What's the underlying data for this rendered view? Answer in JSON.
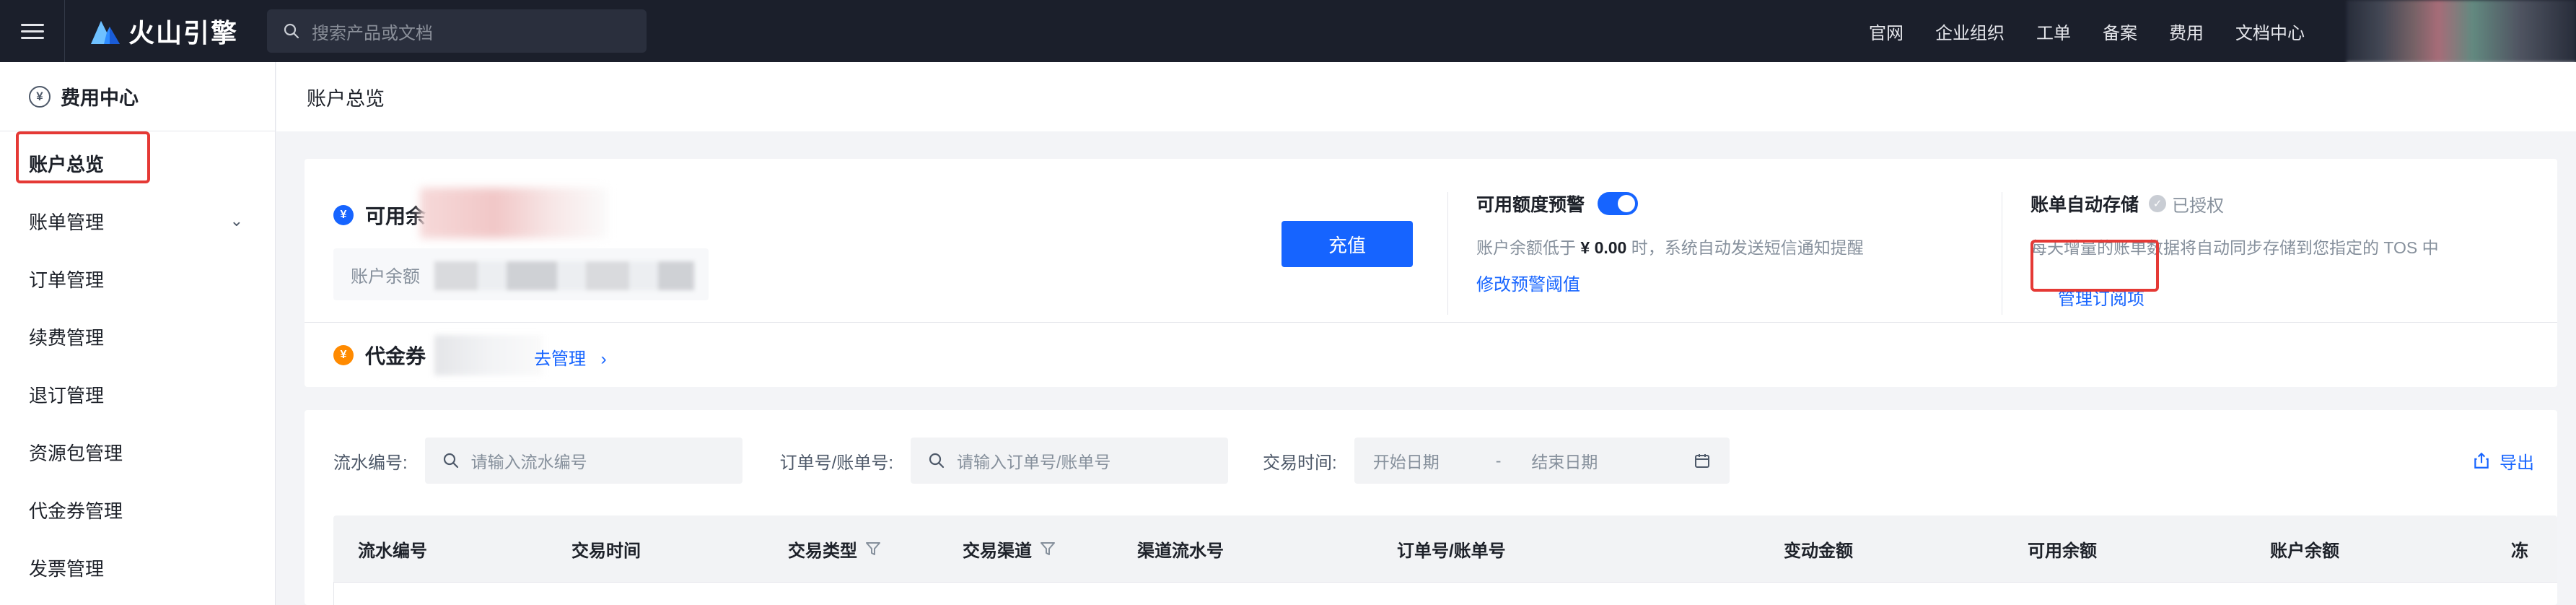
{
  "app": {
    "logo_text": "火山引擎",
    "search_placeholder": "搜索产品或文档"
  },
  "top_nav": [
    "官网",
    "企业组织",
    "工单",
    "备案",
    "费用",
    "文档中心"
  ],
  "sidebar": {
    "title": "费用中心",
    "items": [
      {
        "label": "账户总览",
        "active": true
      },
      {
        "label": "账单管理",
        "expandable": true
      },
      {
        "label": "订单管理"
      },
      {
        "label": "续费管理"
      },
      {
        "label": "退订管理"
      },
      {
        "label": "资源包管理"
      },
      {
        "label": "代金券管理"
      },
      {
        "label": "发票管理"
      }
    ]
  },
  "page": {
    "title": "账户总览"
  },
  "balance": {
    "available_label": "可用余",
    "account_balance_label": "账户余额",
    "recharge_label": "充值"
  },
  "alert": {
    "title": "可用额度预警",
    "enabled": true,
    "desc_prefix": "账户余额低于",
    "threshold": "¥ 0.00",
    "desc_suffix": "时，系统自动发送短信通知提醒",
    "link": "修改预警阈值"
  },
  "auto_store": {
    "title": "账单自动存储",
    "status": "已授权",
    "desc": "每天增量的账单数据将自动同步存储到您指定的 TOS 中",
    "link": "管理订阅项"
  },
  "voucher": {
    "label": "代金券",
    "link": "去管理"
  },
  "filters": {
    "serial_label": "流水编号:",
    "serial_placeholder": "请输入流水编号",
    "order_label": "订单号/账单号:",
    "order_placeholder": "请输入订单号/账单号",
    "time_label": "交易时间:",
    "start_placeholder": "开始日期",
    "range_sep": "-",
    "end_placeholder": "结束日期",
    "export_label": "导出"
  },
  "table": {
    "columns": [
      "流水编号",
      "交易时间",
      "交易类型",
      "交易渠道",
      "渠道流水号",
      "订单号/账单号",
      "变动金额",
      "可用余额",
      "账户余额",
      "冻"
    ]
  },
  "colors": {
    "topbar": "#1b1f2b",
    "primary": "#1664ff",
    "highlight_box": "#e53935"
  }
}
